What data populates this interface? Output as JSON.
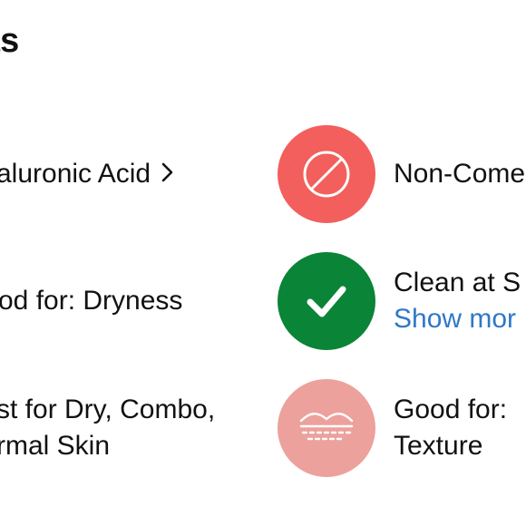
{
  "header": {
    "title": "ts"
  },
  "rows": [
    {
      "left_lines": [
        "aluronic Acid"
      ],
      "left_link": true,
      "icon": "no-comedogenic-icon",
      "icon_bg": "#f25f5c",
      "right_lines": [
        "Non-Come"
      ]
    },
    {
      "left_lines": [
        "od for: Dryness"
      ],
      "left_link": false,
      "icon": "checkmark-icon",
      "icon_bg": "#0a8436",
      "right_lines": [
        "Clean at S"
      ],
      "right_link": "Show mor"
    },
    {
      "left_lines": [
        "st for Dry, Combo,",
        "rmal Skin"
      ],
      "left_link": false,
      "icon": "skin-texture-icon",
      "icon_bg": "#eda19c",
      "right_lines": [
        "Good for:",
        "Texture"
      ]
    }
  ],
  "colors": {
    "link": "#2f78c7",
    "text": "#111111"
  }
}
